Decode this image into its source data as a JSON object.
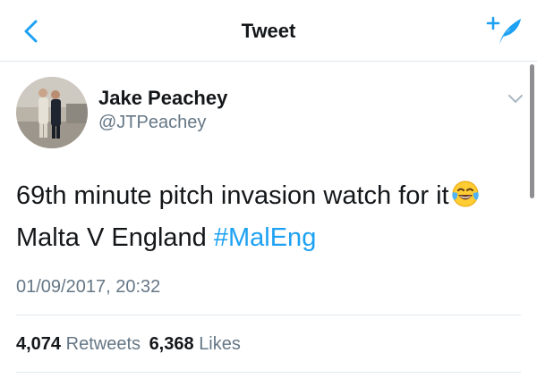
{
  "nav": {
    "title": "Tweet",
    "back_icon": "chevron-left-icon",
    "compose_icon": "compose-tweet-icon",
    "accent_color": "#1da1f2"
  },
  "tweet": {
    "author": {
      "name": "Jake Peachey",
      "handle": "@JTPeachey",
      "avatar_icon": "profile-photo"
    },
    "text_line1": "69th minute pitch invasion watch for it",
    "emoji": "face-with-tears-of-joy",
    "text_line2": "Malta V England ",
    "hashtag": "#MalEng",
    "timestamp": "01/09/2017, 20:32",
    "retweets_count": "4,074",
    "retweets_label": "Retweets",
    "likes_count": "6,368",
    "likes_label": "Likes"
  }
}
